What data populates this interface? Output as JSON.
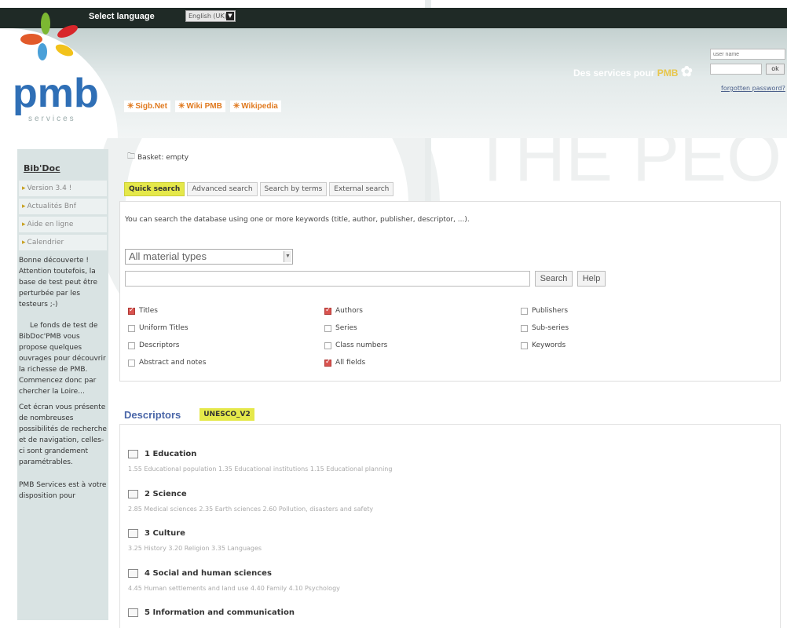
{
  "top_bar": {
    "select_language_label": "Select language",
    "language_value": "English (UK)"
  },
  "logo": {
    "name": "pmb",
    "sub": "services"
  },
  "header": {
    "tagline_prefix": "Des services pour",
    "tagline_brand": "PMB",
    "login": {
      "user_placeholder": "user name",
      "ok_label": "ok",
      "forgot_label": "forgotten password?"
    },
    "links": [
      {
        "label": "Sigb.Net",
        "icon": "star-icon"
      },
      {
        "label": "Wiki PMB",
        "icon": "star-icon"
      },
      {
        "label": "Wikipedia",
        "icon": "star-icon"
      }
    ]
  },
  "sidebar": {
    "title": "Bib'Doc",
    "items": [
      {
        "label": "Version 3.4 !"
      },
      {
        "label": "Actualités Bnf"
      },
      {
        "label": "Aide en ligne"
      },
      {
        "label": "Calendrier"
      }
    ],
    "paragraphs": [
      "Bonne découverte ! Attention toutefois, la base de test peut être perturbée par les testeurs ;-)",
      "Le fonds de test de BibDoc'PMB vous propose quelques ouvrages pour découvrir la richesse de PMB. Commencez donc par chercher la Loire...",
      "Cet écran vous présente de nombreuses possibilités de recherche et de navigation, celles-ci sont grandement paramétrables.",
      "PMB Services est à votre disposition pour"
    ]
  },
  "basket": {
    "label": "Basket: empty"
  },
  "tabs": [
    {
      "label": "Quick search",
      "active": true
    },
    {
      "label": "Advanced search",
      "active": false
    },
    {
      "label": "Search by terms",
      "active": false
    },
    {
      "label": "External search",
      "active": false
    }
  ],
  "search": {
    "help_text": "You can search the database using one or more keywords (title, author, publisher, descriptor, ...).",
    "material_select": "All material types",
    "search_button": "Search",
    "help_button": "Help",
    "checkboxes": [
      {
        "label": "Titles",
        "checked": true
      },
      {
        "label": "Uniform Titles",
        "checked": false
      },
      {
        "label": "Descriptors",
        "checked": false
      },
      {
        "label": "Abstract and notes",
        "checked": false
      },
      {
        "label": "Authors",
        "checked": true
      },
      {
        "label": "Series",
        "checked": false
      },
      {
        "label": "Class numbers",
        "checked": false
      },
      {
        "label": "All fields",
        "checked": true
      },
      {
        "label": "Publishers",
        "checked": false
      },
      {
        "label": "Sub-series",
        "checked": false
      },
      {
        "label": "Keywords",
        "checked": false
      }
    ]
  },
  "descriptors": {
    "title": "Descriptors",
    "thesaurus": "UNESCO_V2",
    "categories": [
      {
        "label": "1 Education",
        "subs": "1.55 Educational population   1.35 Educational institutions   1.15 Educational planning"
      },
      {
        "label": "2 Science",
        "subs": "2.85 Medical sciences   2.35 Earth sciences   2.60 Pollution, disasters and safety"
      },
      {
        "label": "3 Culture",
        "subs": "3.25 History   3.20 Religion   3.35 Languages"
      },
      {
        "label": "4 Social and human sciences",
        "subs": "4.45 Human settlements and land use   4.40 Family   4.10 Psychology"
      },
      {
        "label": "5 Information and communication",
        "subs": ""
      }
    ]
  },
  "colors": {
    "accent_yellow": "#e5e84a",
    "topbar": "#1f2a26",
    "sidebar": "#d9e3e3",
    "link_blue": "#4a66a8",
    "orange": "#e07a20",
    "checkbox_checked": "#d9534f"
  }
}
